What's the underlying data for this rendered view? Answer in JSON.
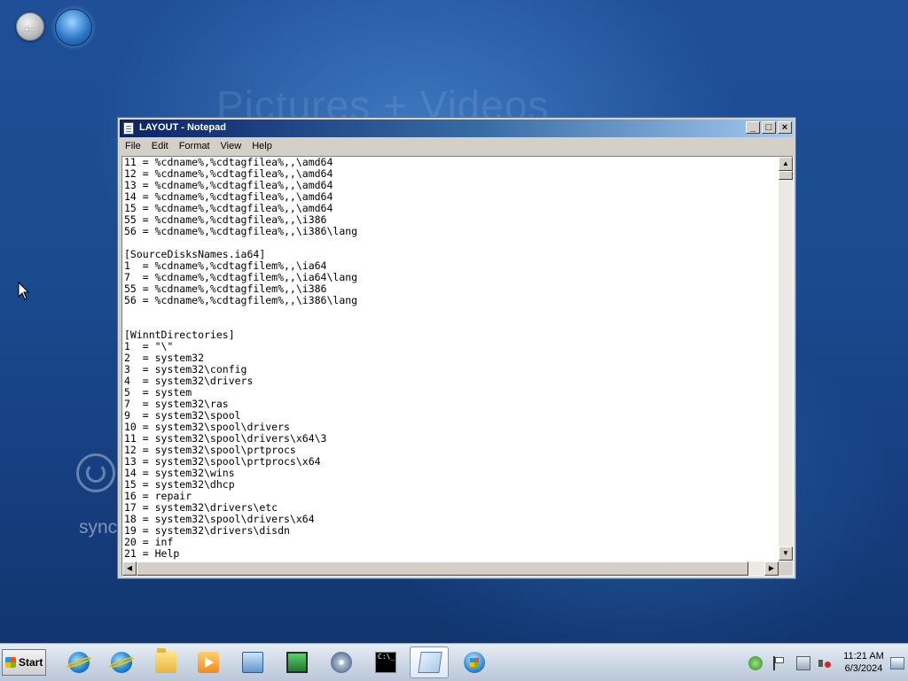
{
  "desktop": {
    "background_title": "Pictures + Videos",
    "sync_label": "sync"
  },
  "window": {
    "title": "LAYOUT - Notepad",
    "buttons": {
      "minimize": "_",
      "maximize": "□",
      "close": "×"
    },
    "menu": [
      "File",
      "Edit",
      "Format",
      "View",
      "Help"
    ],
    "lines": [
      "11 = %cdname%,%cdtagfilea%,,\\amd64",
      "12 = %cdname%,%cdtagfilea%,,\\amd64",
      "13 = %cdname%,%cdtagfilea%,,\\amd64",
      "14 = %cdname%,%cdtagfilea%,,\\amd64",
      "15 = %cdname%,%cdtagfilea%,,\\amd64",
      "55 = %cdname%,%cdtagfilea%,,\\i386",
      "56 = %cdname%,%cdtagfilea%,,\\i386\\lang",
      "",
      "[SourceDisksNames.ia64]",
      "1  = %cdname%,%cdtagfilem%,,\\ia64",
      "7  = %cdname%,%cdtagfilem%,,\\ia64\\lang",
      "55 = %cdname%,%cdtagfilem%,,\\i386",
      "56 = %cdname%,%cdtagfilem%,,\\i386\\lang",
      "",
      "",
      "[WinntDirectories]",
      "1  = \"\\\"",
      "2  = system32",
      "3  = system32\\config",
      "4  = system32\\drivers",
      "5  = system",
      "7  = system32\\ras",
      "9  = system32\\spool",
      "10 = system32\\spool\\drivers",
      "11 = system32\\spool\\drivers\\x64\\3",
      "12 = system32\\spool\\prtprocs",
      "13 = system32\\spool\\prtprocs\\x64",
      "14 = system32\\wins",
      "15 = system32\\dhcp",
      "16 = repair",
      "17 = system32\\drivers\\etc",
      "18 = system32\\spool\\drivers\\x64",
      "19 = system32\\drivers\\disdn",
      "20 = inf",
      "21 = Help"
    ]
  },
  "taskbar": {
    "start_label": "Start",
    "apps": [
      {
        "name": "internet-explorer-icon",
        "active": false
      },
      {
        "name": "internet-explorer-icon-2",
        "active": false
      },
      {
        "name": "folder-icon",
        "active": false
      },
      {
        "name": "media-player-icon",
        "active": false
      },
      {
        "name": "network-icon",
        "active": false
      },
      {
        "name": "monitor-icon",
        "active": false
      },
      {
        "name": "disk-icon",
        "active": false
      },
      {
        "name": "command-prompt-icon",
        "active": false
      },
      {
        "name": "notepad-icon",
        "active": true
      },
      {
        "name": "windows-icon",
        "active": false
      }
    ],
    "cmd_glyph": "C:\\_",
    "clock_time": "11:21 AM",
    "clock_date": "6/3/2024"
  }
}
